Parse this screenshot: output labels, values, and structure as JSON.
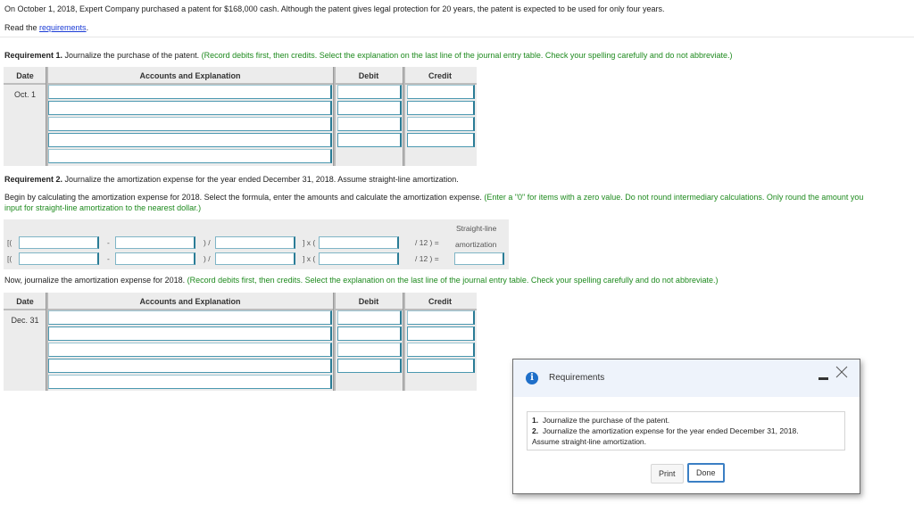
{
  "intro": {
    "problem_text": "On October 1, 2018, Expert Company purchased a patent for $168,000 cash. Although the patent gives legal protection for 20 years, the patent is expected to be used for only four years.",
    "read_prefix": "Read the ",
    "read_link": "requirements",
    "read_suffix": "."
  },
  "req1": {
    "label": "Requirement 1.",
    "text": " Journalize the purchase of the patent. ",
    "instruction": "(Record debits first, then credits. Select the explanation on the last line of the journal entry table. Check your spelling carefully and do not abbreviate.)",
    "table": {
      "headers": [
        "Date",
        "Accounts and Explanation",
        "Debit",
        "Credit"
      ],
      "date": "Oct. 1",
      "rows": [
        {
          "account": "",
          "debit": "",
          "credit": ""
        },
        {
          "account": "",
          "debit": "",
          "credit": ""
        },
        {
          "account": "",
          "debit": "",
          "credit": ""
        },
        {
          "account": "",
          "debit": "",
          "credit": ""
        },
        {
          "account": ""
        }
      ]
    }
  },
  "req2": {
    "label": "Requirement 2.",
    "text": " Journalize the amortization expense for the year ended December 31, 2018. Assume straight-line amortization.",
    "begin_text": "Begin by calculating the amortization expense for 2018. Select the formula, enter the amounts and calculate the amortization expense. ",
    "begin_instruction_1": "(Enter a \"0\" for items with a zero value. Do not round intermediary calculations. Only round the amount you",
    "begin_instruction_2": "input for straight-line amortization to the nearest dollar.)",
    "formula": {
      "result_header_1": "Straight-line",
      "result_header_2": "amortization",
      "open": "[(",
      "minus": "-",
      "div": ") /",
      "times": "] x (",
      "months": "/ 12 ) =",
      "rows": [
        {
          "a": "",
          "b": "",
          "c": "",
          "d": ""
        },
        {
          "a": "",
          "b": "",
          "c": "",
          "d": "",
          "result": ""
        }
      ]
    },
    "now_text": "Now, journalize the amortization expense for 2018. ",
    "now_instruction": "(Record debits first, then credits. Select the explanation on the last line of the journal entry table. Check your spelling carefully and do not abbreviate.)",
    "table": {
      "headers": [
        "Date",
        "Accounts and Explanation",
        "Debit",
        "Credit"
      ],
      "date": "Dec. 31",
      "rows": [
        {
          "account": "",
          "debit": "",
          "credit": ""
        },
        {
          "account": "",
          "debit": "",
          "credit": ""
        },
        {
          "account": "",
          "debit": "",
          "credit": ""
        },
        {
          "account": "",
          "debit": "",
          "credit": ""
        },
        {
          "account": ""
        }
      ]
    }
  },
  "dialog": {
    "icon": "info-icon",
    "title": "Requirements",
    "items": [
      {
        "num": "1.",
        "text": "Journalize the purchase of the patent."
      },
      {
        "num": "2.",
        "text": "Journalize the amortization expense for the year ended December 31, 2018."
      }
    ],
    "item2_cont": "Assume straight-line amortization.",
    "print_label": "Print",
    "done_label": "Done"
  }
}
